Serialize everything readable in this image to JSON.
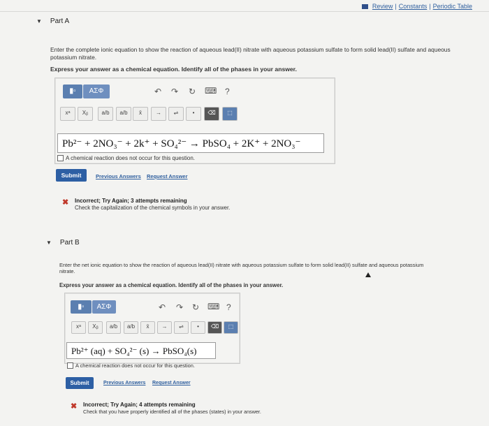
{
  "header": {
    "review": "Review",
    "sep1": "|",
    "constants": "Constants",
    "sep2": "|",
    "periodic": "Periodic Table"
  },
  "partA": {
    "title": "Part A",
    "prompt_line1": "Enter the complete ionic equation to show the reaction of aqueous lead(II) nitrate with aqueous potassium sulfate to form solid lead(II) sulfate and aqueous",
    "prompt_line2": "potassium nitrate.",
    "instruction": "Express your answer as a chemical equation. Identify all of the phases in your answer.",
    "toolbar": {
      "symbols_label": "ΑΣΦ",
      "undo": "↶",
      "redo": "↷",
      "reset": "↻",
      "keyboard": "⌨",
      "help": "?",
      "buttons": [
        "xᵃ",
        "Xᵦ",
        "a/b",
        "a/b",
        "x̄",
        "→",
        "⇌",
        "•",
        "⌫",
        "⬚"
      ]
    },
    "answer": "Pb²⁻ + 2NO₃⁻ + 2k⁺ + SO₄²⁻ → PbSO₄ + 2K⁺ + 2NO₃⁻",
    "no_reaction": "A chemical reaction does not occur for this question.",
    "submit": "Submit",
    "previous": "Previous Answers",
    "request": "Request Answer",
    "feedback_title": "Incorrect; Try Again; 3 attempts remaining",
    "feedback_msg": "Check the capitalization of the chemical symbols in your answer."
  },
  "partB": {
    "title": "Part B",
    "prompt_line1": "Enter the net ionic equation to show the reaction of aqueous lead(II) nitrate with aqueous potassium sulfate to form solid lead(II) sulfate and aqueous potassium",
    "prompt_line2": "nitrate.",
    "instruction": "Express your answer as a chemical equation. Identify all of the phases in your answer.",
    "toolbar": {
      "symbols_label": "ΑΣΦ",
      "undo": "↶",
      "redo": "↷",
      "reset": "↻",
      "keyboard": "⌨",
      "help": "?",
      "buttons": [
        "xᵃ",
        "Xᵦ",
        "a/b",
        "a/b",
        "x̄",
        "→",
        "⇌",
        "•",
        "⌫",
        "⬚"
      ]
    },
    "answer": "Pb²⁺ (aq) + SO₄²⁻ (s) → PbSO₄(s)",
    "no_reaction": "A chemical reaction does not occur for this question.",
    "submit": "Submit",
    "previous": "Previous Answers",
    "request": "Request Answer",
    "feedback_title": "Incorrect; Try Again; 4 attempts remaining",
    "feedback_msg": "Check that you have properly identified all of the phases (states) in your answer."
  },
  "colors": {
    "accent": "#2d5fa4",
    "error": "#c0392b",
    "link": "#2f5f9e"
  }
}
